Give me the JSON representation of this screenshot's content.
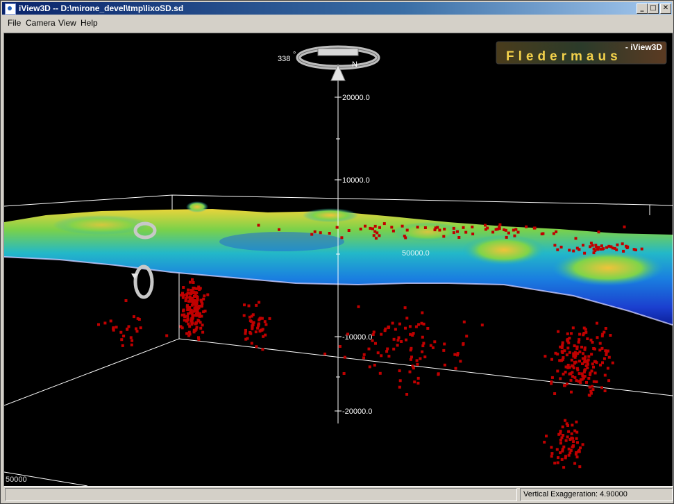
{
  "window": {
    "title": "iView3D -- D:\\mirone_devel\\tmp\\lixoSD.sd",
    "minimize_glyph": "_",
    "maximize_glyph": "□",
    "close_glyph": "✕"
  },
  "menu": {
    "items": [
      "File",
      "Camera",
      "View",
      "Help"
    ]
  },
  "scene": {
    "heading_value": "338",
    "heading_degree_symbol": "°",
    "north_label": "N",
    "vertical_axis_ticks": [
      "20000.0",
      "10000.0",
      "-10000.0",
      "-20000.0"
    ],
    "grid_label": "50000.0",
    "corner_label": "50000",
    "logo_tagline": "- iView3D",
    "logo_text": "Fledermaus"
  },
  "status": {
    "vertical_exaggeration": "Vertical Exaggeration: 4.90000"
  },
  "colors": {
    "title_active": "#0a246a",
    "viewport_background": "#000000",
    "point_color": "#c00000",
    "surface_deep": "#0b2db8",
    "surface_shallow": "#e6e23a"
  },
  "icons": {
    "app": "app-icon",
    "compass": "compass-ring-icon",
    "rotate": "rotate-ring-icon"
  }
}
